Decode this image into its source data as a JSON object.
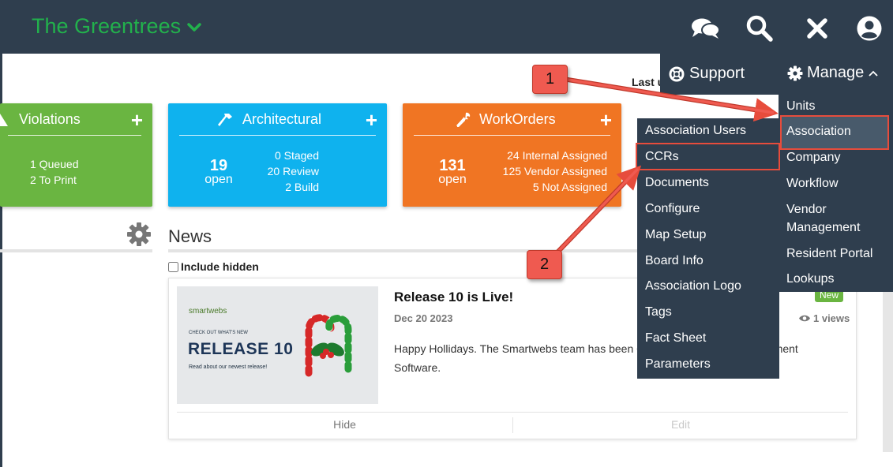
{
  "header": {
    "community_name": "The Greentrees",
    "icons": [
      "chat-icon",
      "search-icon",
      "close-icon",
      "user-icon"
    ]
  },
  "partial_text": "Last u",
  "tiles": {
    "violations": {
      "title": "Violations",
      "plus": "+",
      "stats": [
        "1 Queued",
        "2 To Print"
      ]
    },
    "architectural": {
      "title": "Architectural",
      "plus": "+",
      "count": "19",
      "count_label": "open",
      "stats": [
        "0 Staged",
        "20 Review",
        "2 Build"
      ]
    },
    "workorders": {
      "title": "WorkOrders",
      "plus": "+",
      "count": "131",
      "count_label": "open",
      "stats": [
        "24 Internal Assigned",
        "125 Vendor Assigned",
        "5 Not Assigned"
      ]
    }
  },
  "news": {
    "heading": "News",
    "include_hidden_label": "Include hidden",
    "card": {
      "title": "Release 10 is Live!",
      "date": "Dec 20 2023",
      "badge": "New",
      "views": "1 views",
      "body": "Happy Hollidays. The Smartwebs team has been                                                       OA Accounting and Management Software.",
      "hide_label": "Hide",
      "edit_label": "Edit",
      "image": {
        "brand": "smartwebs",
        "kicker": "CHECK OUT WHAT'S NEW",
        "headline": "RELEASE 10",
        "tagline": "Read about our newest release!"
      }
    }
  },
  "support": {
    "label": "Support"
  },
  "manage": {
    "label": "Manage",
    "items": [
      "Units",
      "Association",
      "Company",
      "Workflow",
      "Vendor Management",
      "Resident Portal",
      "Lookups"
    ]
  },
  "association_submenu": {
    "items": [
      "Association Users",
      "CCRs",
      "Documents",
      "Configure",
      "Map Setup",
      "Board Info",
      "Association Logo",
      "Tags",
      "Fact Sheet",
      "Parameters"
    ]
  },
  "annotations": {
    "step1": "1",
    "step2": "2"
  },
  "colors": {
    "topbar": "#2f3e4e",
    "brand": "#22b14c",
    "violations": "#6ab541",
    "architectural": "#0fb2ee",
    "workorders": "#f07523",
    "highlight": "#e74c3c"
  }
}
